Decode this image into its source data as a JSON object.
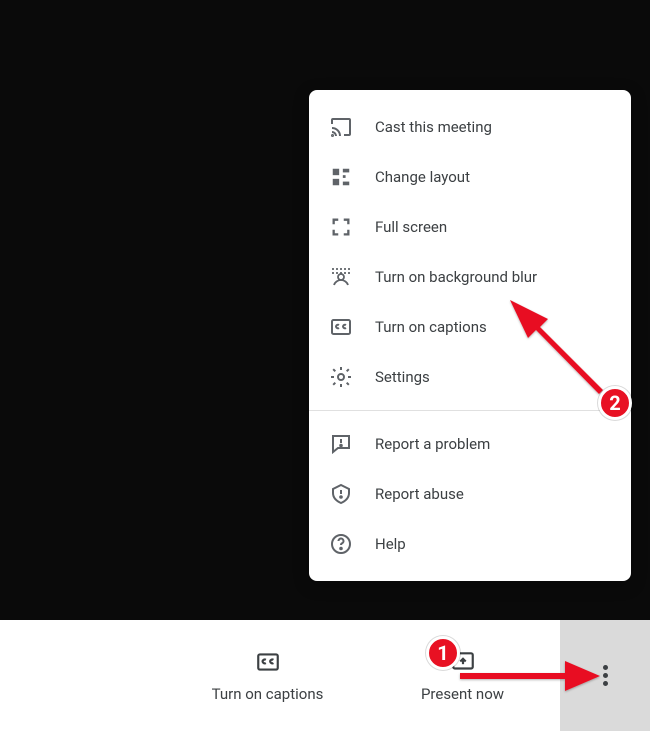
{
  "menu": {
    "items": [
      {
        "label": "Cast this meeting"
      },
      {
        "label": "Change layout"
      },
      {
        "label": "Full screen"
      },
      {
        "label": "Turn on background blur"
      },
      {
        "label": "Turn on captions"
      },
      {
        "label": "Settings"
      }
    ],
    "secondary": [
      {
        "label": "Report a problem"
      },
      {
        "label": "Report abuse"
      },
      {
        "label": "Help"
      }
    ]
  },
  "bottombar": {
    "captions_label": "Turn on captions",
    "present_label": "Present now"
  },
  "annotations": {
    "step1": "1",
    "step2": "2"
  }
}
